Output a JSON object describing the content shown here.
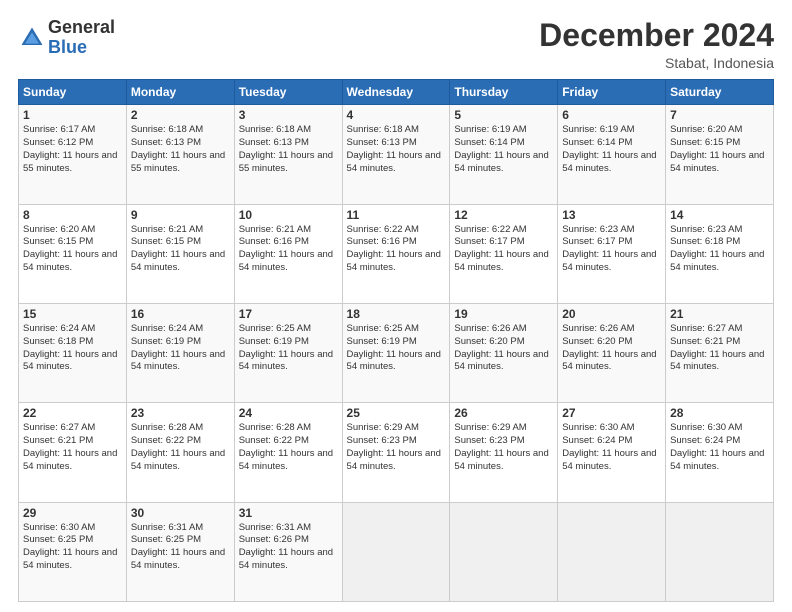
{
  "logo": {
    "general": "General",
    "blue": "Blue"
  },
  "title": "December 2024",
  "location": "Stabat, Indonesia",
  "days_of_week": [
    "Sunday",
    "Monday",
    "Tuesday",
    "Wednesday",
    "Thursday",
    "Friday",
    "Saturday"
  ],
  "weeks": [
    [
      {
        "day": 1,
        "sunrise": "6:17 AM",
        "sunset": "6:12 PM",
        "daylight": "11 hours and 55 minutes"
      },
      {
        "day": 2,
        "sunrise": "6:18 AM",
        "sunset": "6:13 PM",
        "daylight": "11 hours and 55 minutes"
      },
      {
        "day": 3,
        "sunrise": "6:18 AM",
        "sunset": "6:13 PM",
        "daylight": "11 hours and 55 minutes"
      },
      {
        "day": 4,
        "sunrise": "6:18 AM",
        "sunset": "6:13 PM",
        "daylight": "11 hours and 54 minutes"
      },
      {
        "day": 5,
        "sunrise": "6:19 AM",
        "sunset": "6:14 PM",
        "daylight": "11 hours and 54 minutes"
      },
      {
        "day": 6,
        "sunrise": "6:19 AM",
        "sunset": "6:14 PM",
        "daylight": "11 hours and 54 minutes"
      },
      {
        "day": 7,
        "sunrise": "6:20 AM",
        "sunset": "6:15 PM",
        "daylight": "11 hours and 54 minutes"
      }
    ],
    [
      {
        "day": 8,
        "sunrise": "6:20 AM",
        "sunset": "6:15 PM",
        "daylight": "11 hours and 54 minutes"
      },
      {
        "day": 9,
        "sunrise": "6:21 AM",
        "sunset": "6:15 PM",
        "daylight": "11 hours and 54 minutes"
      },
      {
        "day": 10,
        "sunrise": "6:21 AM",
        "sunset": "6:16 PM",
        "daylight": "11 hours and 54 minutes"
      },
      {
        "day": 11,
        "sunrise": "6:22 AM",
        "sunset": "6:16 PM",
        "daylight": "11 hours and 54 minutes"
      },
      {
        "day": 12,
        "sunrise": "6:22 AM",
        "sunset": "6:17 PM",
        "daylight": "11 hours and 54 minutes"
      },
      {
        "day": 13,
        "sunrise": "6:23 AM",
        "sunset": "6:17 PM",
        "daylight": "11 hours and 54 minutes"
      },
      {
        "day": 14,
        "sunrise": "6:23 AM",
        "sunset": "6:18 PM",
        "daylight": "11 hours and 54 minutes"
      }
    ],
    [
      {
        "day": 15,
        "sunrise": "6:24 AM",
        "sunset": "6:18 PM",
        "daylight": "11 hours and 54 minutes"
      },
      {
        "day": 16,
        "sunrise": "6:24 AM",
        "sunset": "6:19 PM",
        "daylight": "11 hours and 54 minutes"
      },
      {
        "day": 17,
        "sunrise": "6:25 AM",
        "sunset": "6:19 PM",
        "daylight": "11 hours and 54 minutes"
      },
      {
        "day": 18,
        "sunrise": "6:25 AM",
        "sunset": "6:19 PM",
        "daylight": "11 hours and 54 minutes"
      },
      {
        "day": 19,
        "sunrise": "6:26 AM",
        "sunset": "6:20 PM",
        "daylight": "11 hours and 54 minutes"
      },
      {
        "day": 20,
        "sunrise": "6:26 AM",
        "sunset": "6:20 PM",
        "daylight": "11 hours and 54 minutes"
      },
      {
        "day": 21,
        "sunrise": "6:27 AM",
        "sunset": "6:21 PM",
        "daylight": "11 hours and 54 minutes"
      }
    ],
    [
      {
        "day": 22,
        "sunrise": "6:27 AM",
        "sunset": "6:21 PM",
        "daylight": "11 hours and 54 minutes"
      },
      {
        "day": 23,
        "sunrise": "6:28 AM",
        "sunset": "6:22 PM",
        "daylight": "11 hours and 54 minutes"
      },
      {
        "day": 24,
        "sunrise": "6:28 AM",
        "sunset": "6:22 PM",
        "daylight": "11 hours and 54 minutes"
      },
      {
        "day": 25,
        "sunrise": "6:29 AM",
        "sunset": "6:23 PM",
        "daylight": "11 hours and 54 minutes"
      },
      {
        "day": 26,
        "sunrise": "6:29 AM",
        "sunset": "6:23 PM",
        "daylight": "11 hours and 54 minutes"
      },
      {
        "day": 27,
        "sunrise": "6:30 AM",
        "sunset": "6:24 PM",
        "daylight": "11 hours and 54 minutes"
      },
      {
        "day": 28,
        "sunrise": "6:30 AM",
        "sunset": "6:24 PM",
        "daylight": "11 hours and 54 minutes"
      }
    ],
    [
      {
        "day": 29,
        "sunrise": "6:30 AM",
        "sunset": "6:25 PM",
        "daylight": "11 hours and 54 minutes"
      },
      {
        "day": 30,
        "sunrise": "6:31 AM",
        "sunset": "6:25 PM",
        "daylight": "11 hours and 54 minutes"
      },
      {
        "day": 31,
        "sunrise": "6:31 AM",
        "sunset": "6:26 PM",
        "daylight": "11 hours and 54 minutes"
      },
      null,
      null,
      null,
      null
    ]
  ]
}
